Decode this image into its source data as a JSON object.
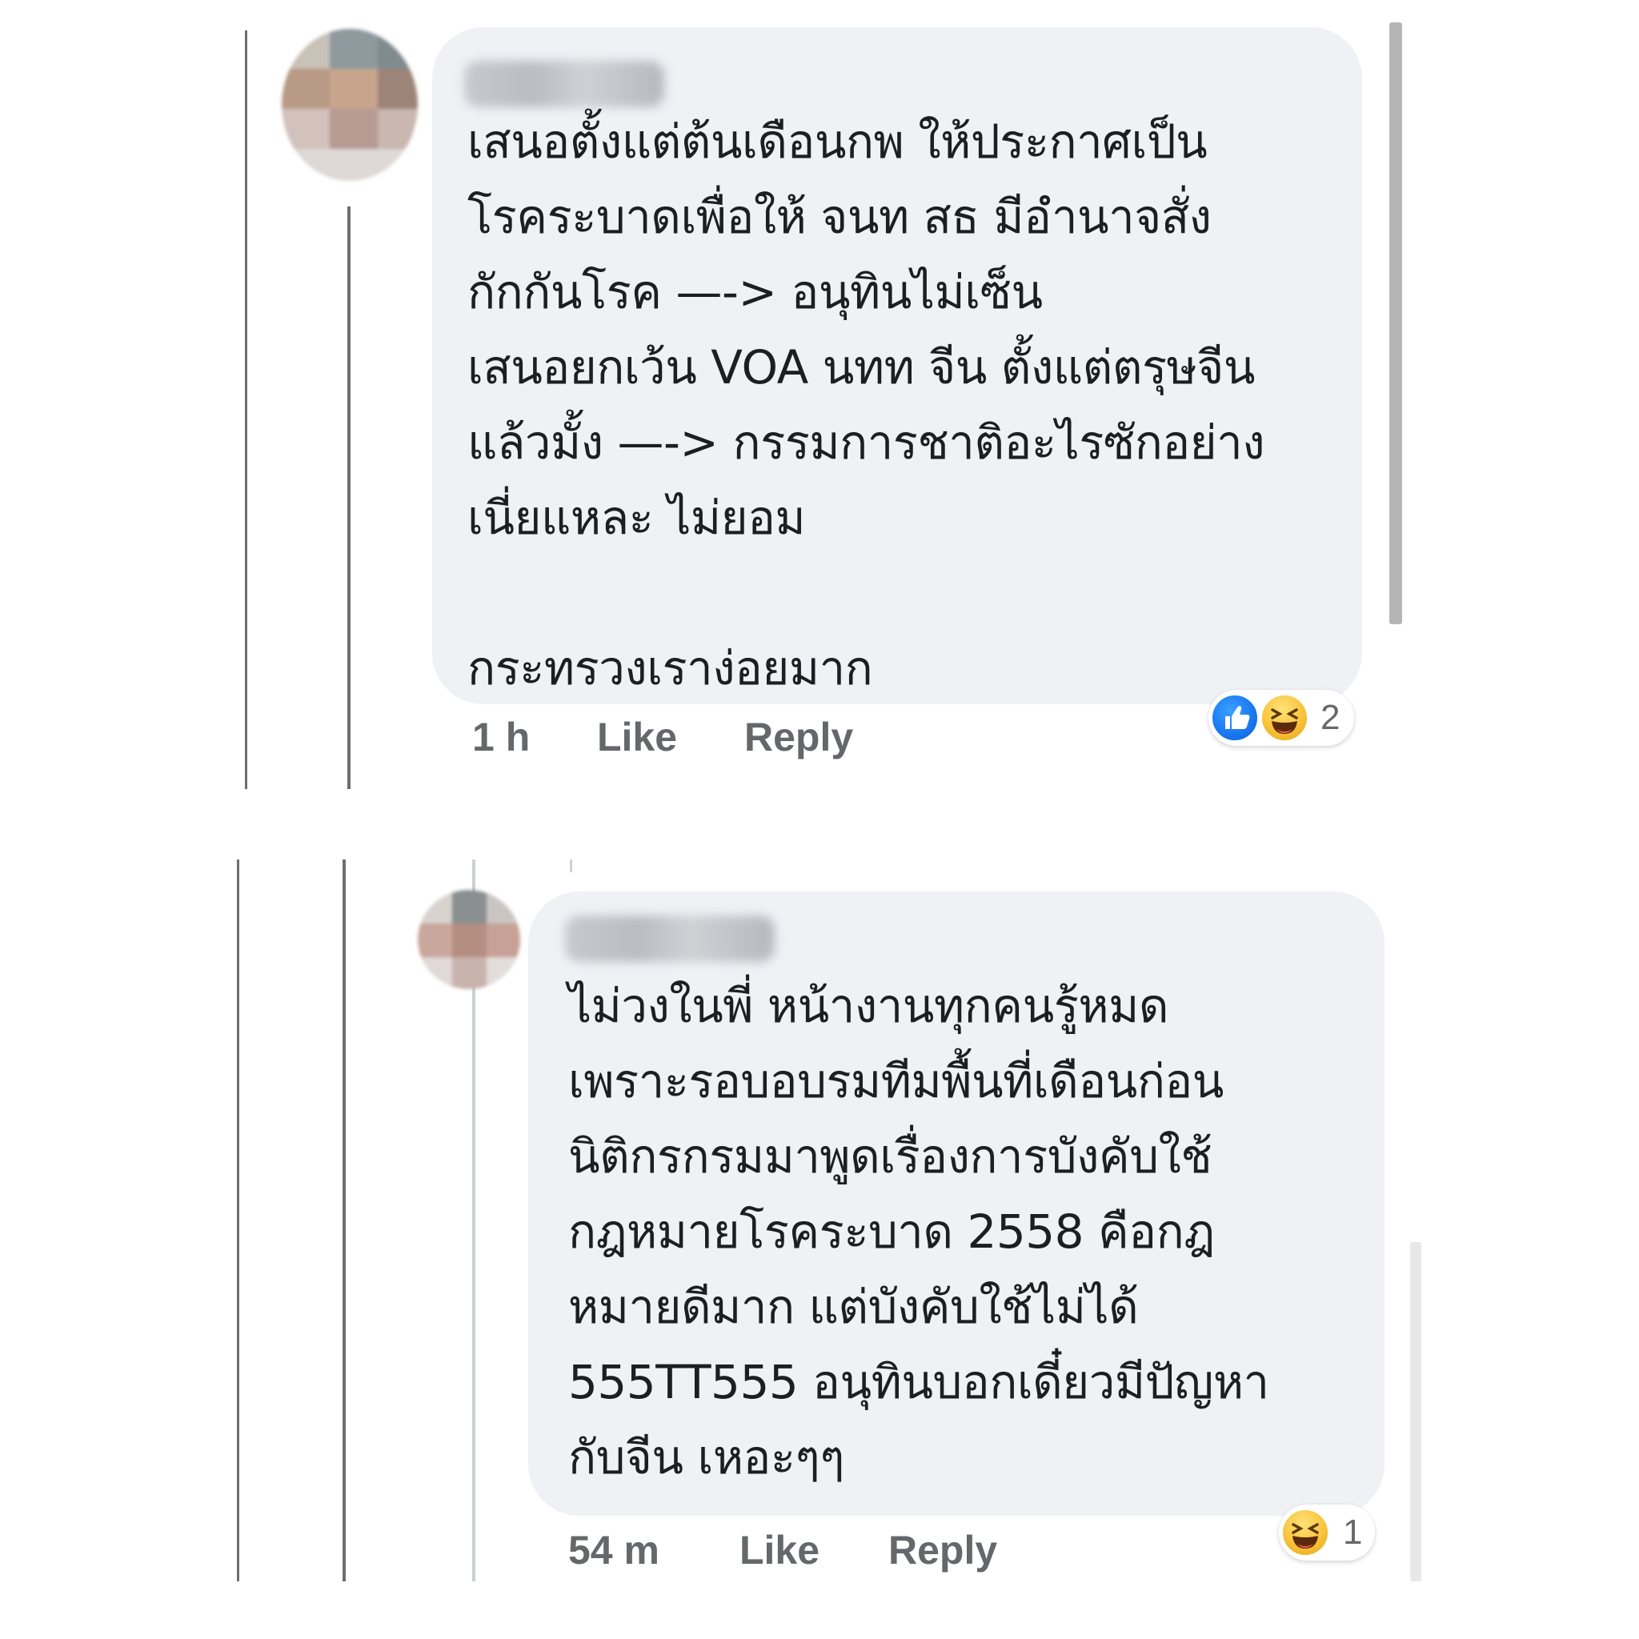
{
  "comments": [
    {
      "text": "เสนอตั้งแต่ต้นเดือนกพ ให้ประกาศเป็น\nโรคระบาดเพื่อให้ จนท สธ มีอำนาจสั่ง\nกักกันโรค —-> อนุทินไม่เซ็น\nเสนอยกเว้น VOA นทท จีน ตั้งแต่ตรุษจีน\nแล้วมั้ง  —-> กรรมการชาติอะไรซักอย่าง\nเนี่ยแหละ ไม่ยอม\n\nกระทรวงเราง่อยมาก",
      "time": "1 h",
      "like_label": "Like",
      "reply_label": "Reply",
      "reactions": [
        "like-icon",
        "haha-icon"
      ],
      "reaction_count": "2"
    },
    {
      "text": "ไม่วงในพี่ หน้างานทุกคนรู้หมด\nเพราะรอบอบรมทีมพื้นที่เดือนก่อน\nนิติกรกรมมาพูดเรื่องการบังคับใช้\nกฎหมายโรคระบาด 2558 คือกฎ\nหมายดีมาก แต่บังคับใช้ไม่ได้\n555TT555 อนุทินบอกเดี๋ยวมีปัญหา\nกับจีน เหอะๆๆ",
      "time": "54 m",
      "like_label": "Like",
      "reply_label": "Reply",
      "reactions": [
        "haha-icon"
      ],
      "reaction_count": "1"
    }
  ],
  "colors": {
    "bubble": "#f0f1f5",
    "meta_text": "#65676b",
    "like_blue": "#1877f2",
    "haha_yellow": "#f7c33a"
  }
}
